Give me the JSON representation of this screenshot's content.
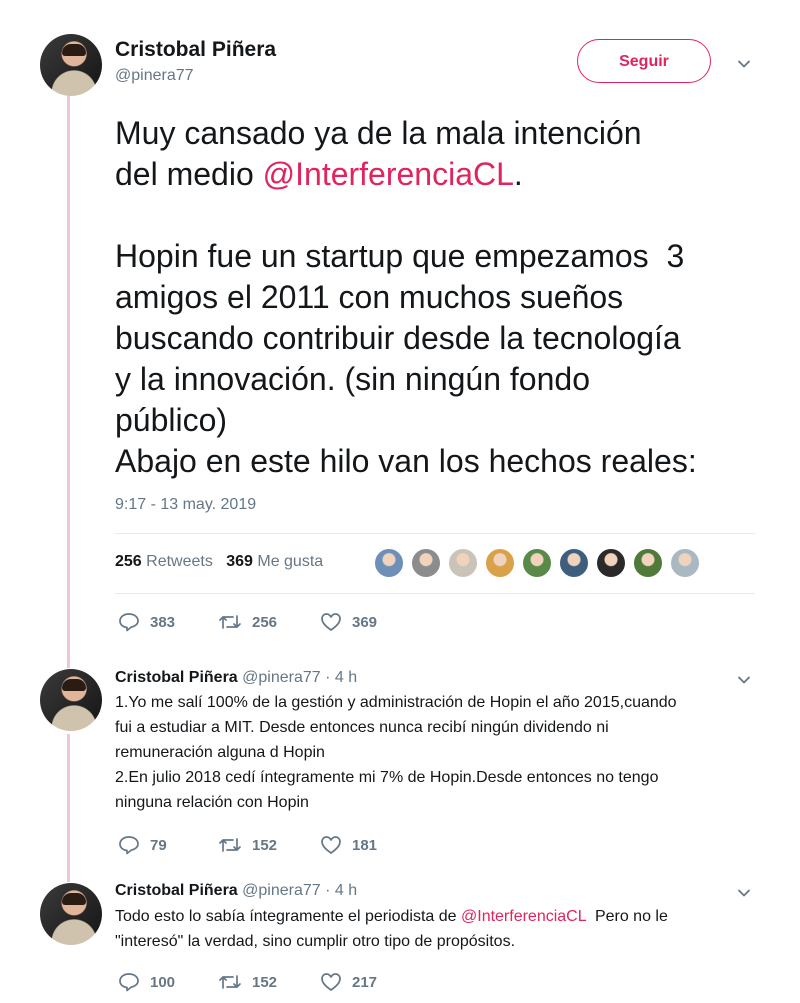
{
  "main": {
    "author_name": "Cristobal Piñera",
    "author_handle": "@pinera77",
    "follow_label": "Seguir",
    "text_line1": "Muy cansado ya de la mala intención",
    "text_line2_prefix": "del medio ",
    "text_mention": "@InterferenciaCL",
    "text_line2_suffix": ".",
    "text_para2": "Hopin fue un startup que empezamos  3\namigos el 2011 con muchos sueños\nbuscando contribuir desde la tecnología\ny la innovación. (sin ningún fondo\npúblico)\nAbajo en este hilo van los hechos reales:",
    "timestamp": "9:17 - 13 may. 2019",
    "retweet_count": "256",
    "retweet_label": "Retweets",
    "like_count": "369",
    "like_label": "Me gusta",
    "reply_action_count": "383",
    "retweet_action_count": "256",
    "like_action_count": "369"
  },
  "liker_colors": [
    "#6e8fb8",
    "#8c8c8c",
    "#c9c3b8",
    "#d9a24a",
    "#5a8a4a",
    "#3e5e7e",
    "#2a2a2a",
    "#4f7a3a",
    "#aab8c2"
  ],
  "replies": [
    {
      "author_name": "Cristobal Piñera",
      "author_handle": "@pinera77",
      "time_ago": "· 4 h",
      "line1": "1.Yo me salí 100% de la gestión y administración de Hopin el año 2015,cuando",
      "line2": "fui a estudiar a MIT. Desde entonces nunca recibí ningún dividendo ni",
      "line3": "remuneración alguna d Hopin",
      "line4": "2.En julio 2018 cedí íntegramente mi 7% de Hopin.Desde entonces no tengo",
      "line5": "ninguna relación con Hopin",
      "reply_count": "79",
      "retweet_count": "152",
      "like_count": "181"
    },
    {
      "author_name": "Cristobal Piñera",
      "author_handle": "@pinera77",
      "time_ago": "· 4 h",
      "line1_prefix": "Todo esto lo sabía íntegramente el periodista de ",
      "line1_mention": "@InterferenciaCL",
      "line1_suffix": "  Pero no le",
      "line2": "\"interesó\" la verdad, sino cumplir otro tipo de propósitos.",
      "reply_count": "100",
      "retweet_count": "152",
      "like_count": "217"
    }
  ]
}
